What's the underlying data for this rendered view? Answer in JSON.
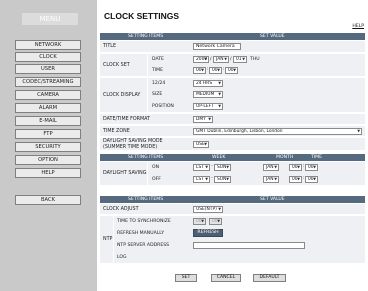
{
  "sidebar": {
    "menu_title": "MENU",
    "items": [
      {
        "label": "NETWORK"
      },
      {
        "label": "CLOCK"
      },
      {
        "label": "USER"
      },
      {
        "label": "CODEC/STREAMING"
      },
      {
        "label": "CAMERA"
      },
      {
        "label": "ALARM"
      },
      {
        "label": "E-MAIL"
      },
      {
        "label": "FTP"
      },
      {
        "label": "SECURITY"
      },
      {
        "label": "OPTION"
      },
      {
        "label": "HELP"
      }
    ],
    "back_label": "BACK"
  },
  "header": {
    "title": "CLOCK SETTINGS",
    "help": "HELP"
  },
  "table1": {
    "col_items": "SETTING ITEMS",
    "col_value": "SET VALUE",
    "title_label": "TITLE",
    "title_value": "Network Camera",
    "clock_set_label": "CLOCK SET",
    "date_label": "DATE",
    "date_year": "2009",
    "date_month": "JAN",
    "date_day": "01",
    "date_dow": "THU",
    "time_label": "TIME",
    "time_h": "00",
    "time_m": "00",
    "time_s": "00",
    "clock_display_label": "CLOCK DISPLAY",
    "format_label": "12/24",
    "format_value": "24 HRS",
    "size_label": "SIZE",
    "size_value": "MEDIUM",
    "position_label": "POSITION",
    "position_value": "UP-LEFT",
    "date_format_label": "DATE/TIME FORMAT",
    "date_format_value": "DMY",
    "timezone_label": "TIME ZONE",
    "timezone_value": "GMT Dublin, Edinburgh, Lisbon, London",
    "dst_label_1": "DAYLIGHT SAVING MODE",
    "dst_label_2": "(SUMMER TIME MODE)",
    "dst_value": "USE"
  },
  "dst": {
    "col_items": "SETTING ITEMS",
    "col_week": "WEEK",
    "col_month": "MONTH",
    "col_time": "TIME",
    "group_label": "DAYLIGHT SAVING",
    "on_label": "ON",
    "on_week": "LST",
    "on_day": "SUN",
    "on_month": "JAN",
    "on_h": "00",
    "on_m": "00",
    "off_label": "OFF",
    "off_week": "LST",
    "off_day": "SUN",
    "off_month": "JAN",
    "off_h": "00",
    "off_m": "00"
  },
  "ntp": {
    "col_items": "SETTING ITEMS",
    "col_value": "SET VALUE",
    "group_label": "NTP",
    "clock_adjust_label": "CLOCK ADJUST",
    "clock_adjust_value": "USE(NTP)",
    "sync_label": "TIME TO SYNCHRONIZE",
    "sync_h": "00",
    "sync_m": "00",
    "refresh_label": "REFRESH MANUALLY",
    "refresh_button": "REFRESH",
    "server_label": "NTP SERVER ADDRESS",
    "server_value": "",
    "log_label": "LOG",
    "log_value": ""
  },
  "footer": {
    "set": "SET",
    "cancel": "CANCEL",
    "default": "DEFAULT"
  },
  "colors": {
    "header": "#55697f",
    "row": "#eef0f4",
    "sidebar": "#c9c9c9"
  }
}
